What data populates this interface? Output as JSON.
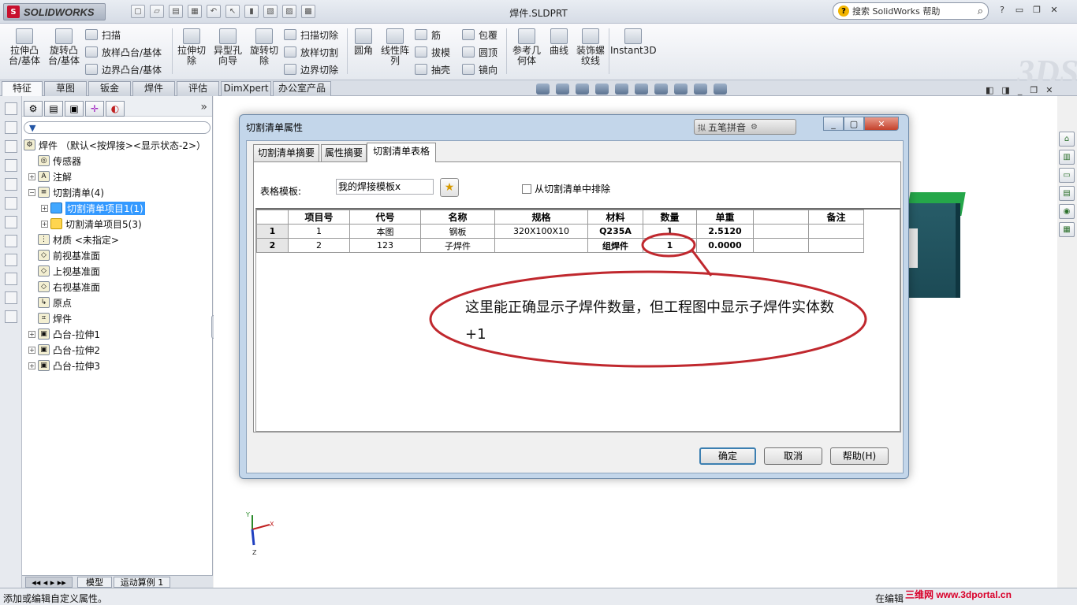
{
  "window": {
    "app_name": "SOLIDWORKS",
    "logo_mark": "S",
    "doc_title": "焊件.SLDPRT",
    "search_placeholder": "搜索 SolidWorks 帮助",
    "help_label": "?",
    "minimize": "▭",
    "restore": "❐",
    "close": "✕"
  },
  "ribbon": {
    "extrude_boss": "拉伸凸\n台/基体",
    "revolve_boss": "旋转凸\n台/基体",
    "sweep": "扫描",
    "loft_boss": "放样凸台/基体",
    "boundary_boss": "边界凸台/基体",
    "extrude_cut": "拉伸切\n除",
    "hole_wizard": "异型孔\n向导",
    "revolve_cut": "旋转切\n除",
    "swept_cut": "扫描切除",
    "lofted_cut": "放样切割",
    "boundary_cut": "边界切除",
    "fillet": "圆角",
    "linear_pattern": "线性阵\n列",
    "rib": "筋",
    "draft": "拔模",
    "shell": "抽壳",
    "wrap": "包覆",
    "dome": "圆顶",
    "mirror": "镜向",
    "ref_geometry": "参考几\n何体",
    "curves": "曲线",
    "cosmetic_thread": "装饰螺\n纹线",
    "instant3d": "Instant3D"
  },
  "command_tabs": [
    "特征",
    "草图",
    "钣金",
    "焊件",
    "评估",
    "DimXpert",
    "办公室产品"
  ],
  "feature_tree": {
    "root": "焊件 （默认<按焊接><显示状态-2>）",
    "items": [
      {
        "label": "传感器",
        "expand": "",
        "icon": "◎"
      },
      {
        "label": "注解",
        "expand": "+",
        "icon": "A"
      },
      {
        "label": "切割清单(4)",
        "expand": "−",
        "icon": "≡"
      },
      {
        "label": "切割清单项目1(1)",
        "expand": "+",
        "icon": ""
      },
      {
        "label": "切割清单项目5(3)",
        "expand": "+",
        "icon": ""
      },
      {
        "label": "材质 <未指定>",
        "expand": "",
        "icon": "⋮"
      },
      {
        "label": "前视基准面",
        "expand": "",
        "icon": "◇"
      },
      {
        "label": "上视基准面",
        "expand": "",
        "icon": "◇"
      },
      {
        "label": "右视基准面",
        "expand": "",
        "icon": "◇"
      },
      {
        "label": "原点",
        "expand": "",
        "icon": "↳"
      },
      {
        "label": "焊件",
        "expand": "",
        "icon": "⌗"
      },
      {
        "label": "凸台-拉伸1",
        "expand": "+",
        "icon": "▣"
      },
      {
        "label": "凸台-拉伸2",
        "expand": "+",
        "icon": "▣"
      },
      {
        "label": "凸台-拉伸3",
        "expand": "+",
        "icon": "▣"
      }
    ],
    "chevron": "»",
    "filter_icon": "▼",
    "bottom_tabs": [
      "模型",
      "运动算例 1"
    ]
  },
  "dialog": {
    "title": "切割清单属性",
    "ime_label": "五笔拼音",
    "tabs": [
      "切割清单摘要",
      "属性摘要",
      "切割清单表格"
    ],
    "template_label": "表格模板:",
    "template_value": "我的焊接模板x",
    "exclude_label": "从切割清单中排除",
    "table": {
      "headers": [
        "",
        "项目号",
        "代号",
        "名称",
        "规格",
        "材料",
        "数量",
        "单重",
        "",
        "备注"
      ],
      "rows": [
        [
          "1",
          "1",
          "本图",
          "钢板",
          "320X100X10",
          "Q235A",
          "1",
          "2.5120",
          "",
          ""
        ],
        [
          "2",
          "2",
          "123",
          "子焊件",
          "",
          "组焊件",
          "1",
          "0.0000",
          "",
          ""
        ]
      ]
    },
    "ok": "确定",
    "cancel": "取消",
    "help": "帮助(H)"
  },
  "annotation": {
    "text": "这里能正确显示子焊件数量，但工程图中显示子焊件实体数+1",
    "color": "#c0282e"
  },
  "triad": {
    "y": "Y",
    "x": "X",
    "z": "Z"
  },
  "status": {
    "left": "添加或编辑自定义属性。",
    "right": "在编辑",
    "watermark": "三维网 www.3dportal.cn"
  }
}
